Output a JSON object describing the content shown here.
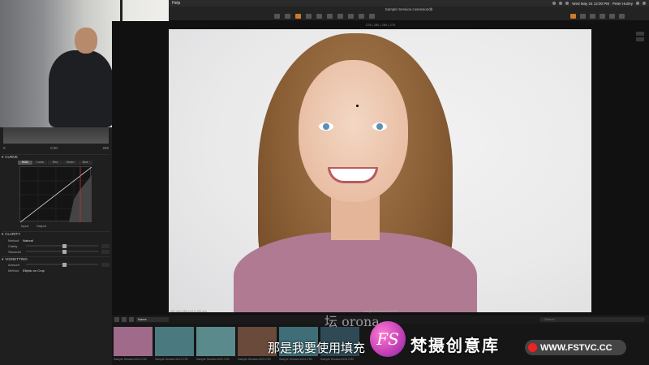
{
  "menubar": {
    "app_menu": "Help",
    "datetime": "Wed May 24 12:00 PM",
    "user": "Peter Hurley"
  },
  "toolbar": {
    "session_title": "Sample Session.cosessiondb"
  },
  "viewer": {
    "counter": "278 | 280 | 284 | 270",
    "info": "ISO 400    1/80 s    f/2.8    105 mm",
    "filename": "Sample Session1024.CR2"
  },
  "left_panel": {
    "histogram": {
      "min": "0",
      "mid": "0.00",
      "max": "255"
    },
    "curve": {
      "title": "CURVE",
      "tabs": [
        "RGB",
        "Luma",
        "Red",
        "Green",
        "Blue"
      ],
      "active_tab": "RGB",
      "input_label": "Input",
      "output_label": "Output"
    },
    "clarity": {
      "title": "CLARITY",
      "method_label": "Method",
      "method_value": "Natural",
      "clarity_label": "Clarity",
      "structure_label": "Structure"
    },
    "vignetting": {
      "title": "VIGNETTING",
      "amount_label": "Amount",
      "method_label": "Method",
      "method_value": "Elliptic on Crop"
    }
  },
  "browser": {
    "album": "Name",
    "search_placeholder": "Search",
    "thumbnails": [
      {
        "caption": "Sample Session1024.CR2",
        "color": "#a06a8a"
      },
      {
        "caption": "Sample Session1021.CR2",
        "color": "#4a7a80"
      },
      {
        "caption": "Sample Session1022.CR2",
        "color": "#5b8a8c"
      },
      {
        "caption": "Sample Session1023.CR2",
        "color": "#6a4a3a"
      },
      {
        "caption": "Sample Session1024.CR2",
        "color": "#3f6e78"
      },
      {
        "caption": "Sample Session1025.CR2",
        "color": "#2f4a55"
      }
    ]
  },
  "overlay": {
    "subtitle": "那是我要使用填充",
    "ghost_text": "坛 orona",
    "watermark_logo": "FS",
    "watermark_title": "梵摄创意库",
    "watermark_url": "WWW.FSTVC.CC"
  }
}
